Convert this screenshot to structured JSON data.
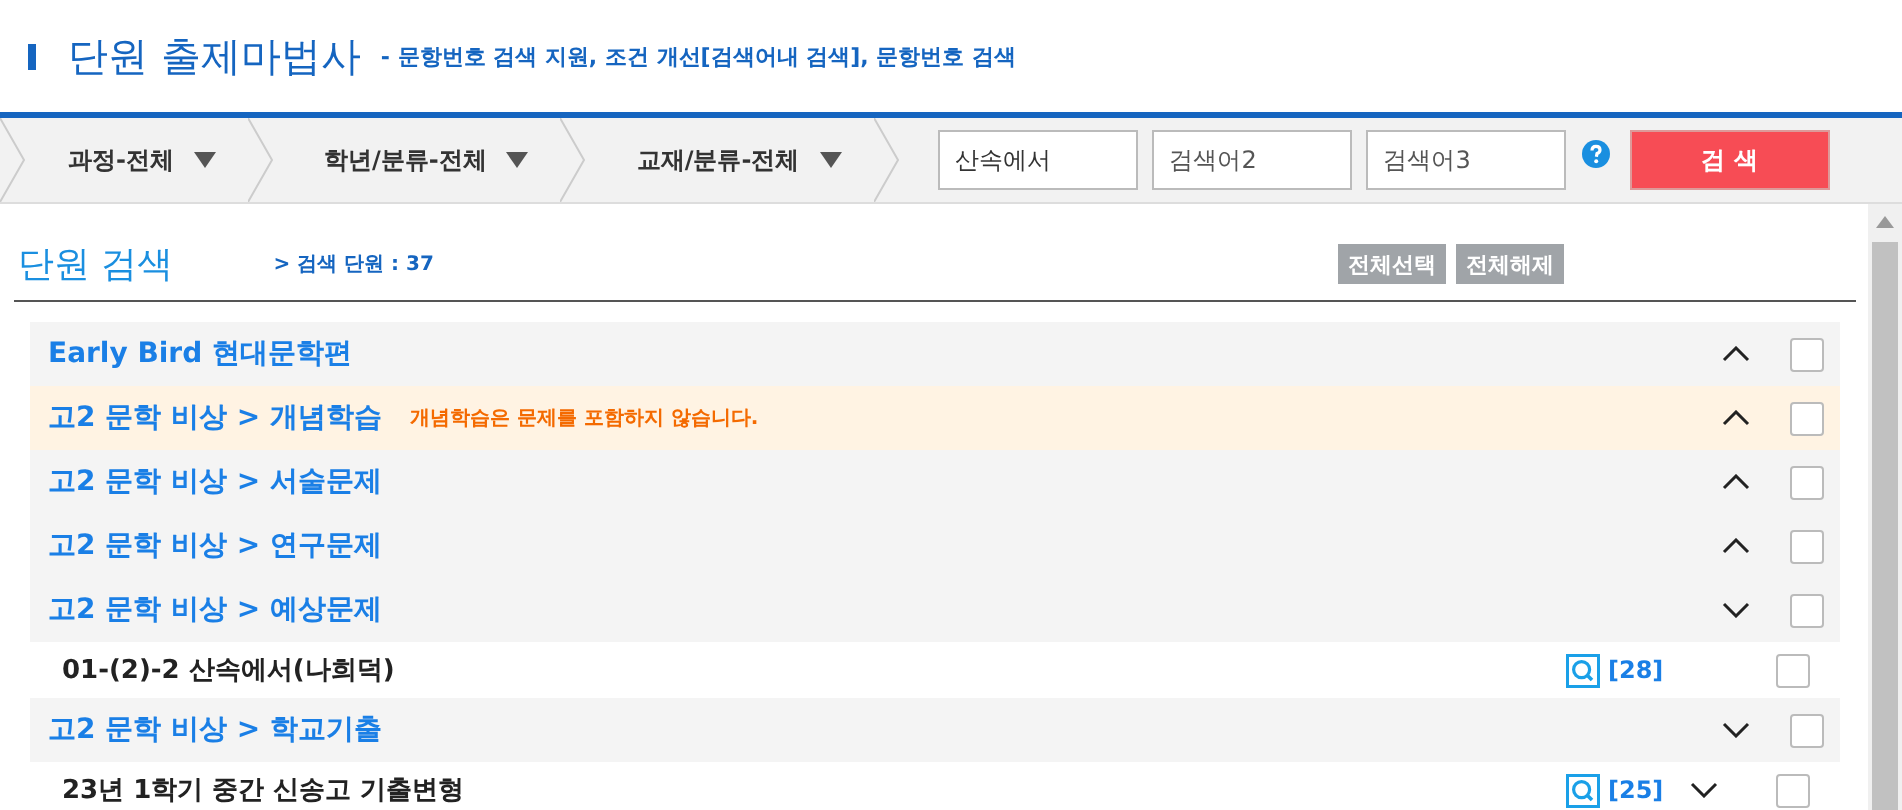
{
  "header": {
    "title": "단원 출제마법사",
    "subtitle": "- 문항번호 검색 지원, 조건 개선[검색어내 검색], 문항번호 검색"
  },
  "filters": [
    {
      "label": "과정-전체"
    },
    {
      "label": "학년/분류-전체"
    },
    {
      "label": "교재/분류-전체"
    }
  ],
  "search_fields": [
    {
      "value": "산속에서"
    },
    {
      "placeholder": "검색어2"
    },
    {
      "placeholder": "검색어3"
    }
  ],
  "search_button": "검 색",
  "section": {
    "title": "단원 검색",
    "count": "> 검색 단원 : 37",
    "buttons": [
      "전체선택",
      "전체해제"
    ]
  },
  "groups": [
    {
      "title": "Early Bird 현대문학편",
      "highlighted": false,
      "expanded": false,
      "checked": false
    },
    {
      "title": "고2 문학 비상 > 개념학습",
      "note": "개념학습은 문제를 포함하지 않습니다.",
      "highlighted": true,
      "expanded": false,
      "checked": false
    },
    {
      "title": "고2 문학 비상 > 서술문제",
      "highlighted": false,
      "expanded": false,
      "checked": false
    },
    {
      "title": "고2 문학 비상 > 연구문제",
      "highlighted": false,
      "expanded": false,
      "checked": false
    },
    {
      "title": "고2 문학 비상 > 예상문제",
      "highlighted": false,
      "expanded": true,
      "checked": false,
      "children": [
        {
          "title": "01-(2)-2 산속에서(나희덕)",
          "count": "[28]",
          "kind": "leaf",
          "checked": false
        }
      ]
    },
    {
      "title": "고2 문학 비상 > 학교기출",
      "highlighted": false,
      "expanded": true,
      "checked": false,
      "children": [
        {
          "title": "23년 1학기 중간 신송고 기출변형",
          "count": "[25]",
          "kind": "branch",
          "expanded": true,
          "checked": false
        }
      ]
    }
  ]
}
